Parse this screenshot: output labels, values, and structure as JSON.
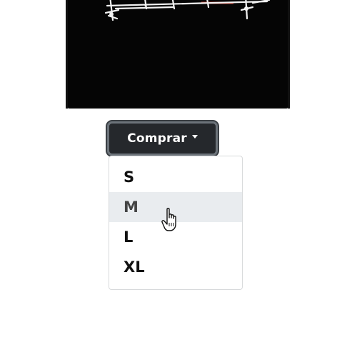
{
  "product": {
    "image_icon": "black-tshirt-with-white-graphic",
    "colors": {
      "shirt": "#050505",
      "graphic": "#f2f2f2",
      "accent": "#c0392b"
    }
  },
  "buy_dropdown": {
    "label": "Comprar",
    "caret_icon": "caret-down-icon",
    "colors": {
      "button_bg": "#25282c",
      "button_border": "#6c737a",
      "item_hover_bg": "#e9ecef"
    },
    "options": [
      {
        "label": "S",
        "hovered": false
      },
      {
        "label": "M",
        "hovered": true
      },
      {
        "label": "L",
        "hovered": false
      },
      {
        "label": "XL",
        "hovered": false
      }
    ]
  },
  "cursor": {
    "icon": "hand-pointer-icon"
  }
}
